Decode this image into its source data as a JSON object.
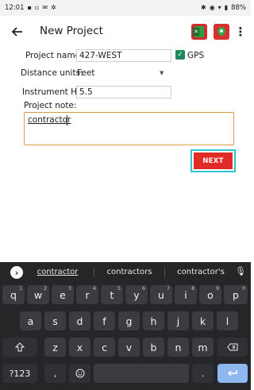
{
  "status_bar": {
    "time": "12:01",
    "left_icons": [
      "notification-icon",
      "gallery-icon",
      "mail-icon",
      "settings-icon"
    ],
    "battery": "88%"
  },
  "app_bar": {
    "title": "New Project",
    "icons": [
      "back-arrow-icon",
      "excel-export-icon",
      "map-pin-icon",
      "overflow-menu-icon"
    ]
  },
  "form": {
    "project_name_label": "Project name:",
    "project_name_value": "427-WEST",
    "gps_label": "GPS",
    "gps_checked": true,
    "distance_units_label": "Distance units:",
    "distance_units_value": "Feet",
    "instrument_ht_label": "Instrument Ht:",
    "instrument_ht_value": "5.5",
    "project_note_label": "Project note:",
    "project_note_value": "contractor",
    "next_label": "NEXT"
  },
  "keyboard": {
    "suggestions": [
      "contractor",
      "contractors",
      "contractor's"
    ],
    "row1": [
      {
        "key": "q",
        "hint": "1"
      },
      {
        "key": "w",
        "hint": "2"
      },
      {
        "key": "e",
        "hint": "3"
      },
      {
        "key": "r",
        "hint": "4"
      },
      {
        "key": "t",
        "hint": "5"
      },
      {
        "key": "y",
        "hint": "6"
      },
      {
        "key": "u",
        "hint": "7"
      },
      {
        "key": "i",
        "hint": "8"
      },
      {
        "key": "o",
        "hint": "9"
      },
      {
        "key": "p",
        "hint": "0"
      }
    ],
    "row2": [
      "a",
      "s",
      "d",
      "f",
      "g",
      "h",
      "j",
      "k",
      "l"
    ],
    "row3": [
      "z",
      "x",
      "c",
      "v",
      "b",
      "n",
      "m"
    ],
    "symbols_label": "?123",
    "comma_label": ",",
    "period_label": ".",
    "colors": {
      "background": "#252628",
      "key": "#3b3c3f",
      "enter": "#8fb8f0"
    }
  },
  "colors": {
    "accent_red": "#e12b26",
    "focus_outline": "#2ec5d3",
    "checkbox": "#1f8b5c",
    "note_border": "#d6a044"
  }
}
